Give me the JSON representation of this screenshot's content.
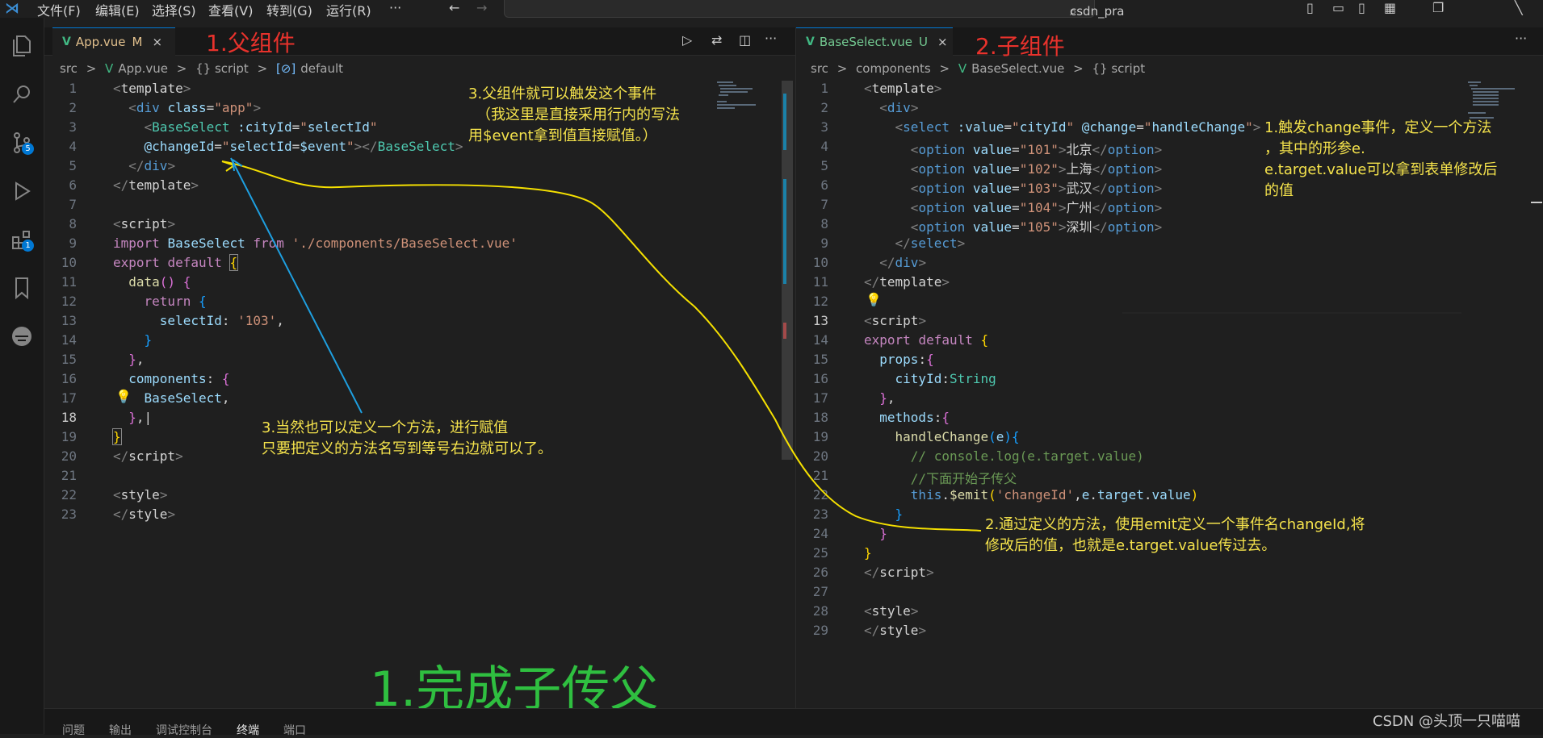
{
  "titlebar": {
    "menus": [
      "文件(F)",
      "编辑(E)",
      "选择(S)",
      "查看(V)",
      "转到(G)",
      "运行(R)",
      "···"
    ],
    "search": "csdn_pra"
  },
  "activity_badges": {
    "scm": "5",
    "extensions": "1"
  },
  "left_editor": {
    "tab_name": "App.vue",
    "tab_status": "M",
    "tab_close": "×",
    "annotation": "1.父组件",
    "breadcrumb": [
      "src",
      ">",
      "App.vue",
      ">",
      "{} script",
      ">",
      "default"
    ],
    "line_numbers": [
      "1",
      "2",
      "3",
      "4",
      "5",
      "6",
      "7",
      "8",
      "9",
      "10",
      "11",
      "12",
      "13",
      "14",
      "15",
      "16",
      "17",
      "18",
      "19",
      "20",
      "21",
      "22",
      "23"
    ]
  },
  "right_editor": {
    "tab_name": "BaseSelect.vue",
    "tab_status": "U",
    "tab_close": "×",
    "annotation": "2.子组件",
    "breadcrumb": [
      "src",
      ">",
      "components",
      ">",
      "BaseSelect.vue",
      ">",
      "{} script"
    ],
    "line_numbers": [
      "1",
      "2",
      "3",
      "4",
      "5",
      "6",
      "7",
      "8",
      "9",
      "10",
      "11",
      "12",
      "13",
      "14",
      "15",
      "16",
      "17",
      "18",
      "19",
      "20",
      "21",
      "22",
      "23",
      "24",
      "25",
      "26",
      "27",
      "28",
      "29"
    ]
  },
  "notes": {
    "parent_event": [
      "3.父组件就可以触发这个事件",
      "（我这里是直接采用行内的写法",
      "用$event拿到值直接赋值。）"
    ],
    "method_assign": [
      "3.当然也可以定义一个方法，进行赋值",
      "只要把定义的方法名写到等号右边就可以了。"
    ],
    "child_change": [
      "1.触发change事件，定义一个方法",
      "，其中的形参e.",
      "e.target.value可以拿到表单修改后",
      "的值"
    ],
    "emit": [
      "2.通过定义的方法，使用emit定义一个事件名changeId,将",
      "修改后的值，也就是e.target.value传过去。"
    ],
    "big_title": "1.完成子传父"
  },
  "panel_tabs": [
    "问题",
    "输出",
    "调试控制台",
    "终端",
    "端口"
  ],
  "watermark": "CSDN @头顶一只喵喵"
}
